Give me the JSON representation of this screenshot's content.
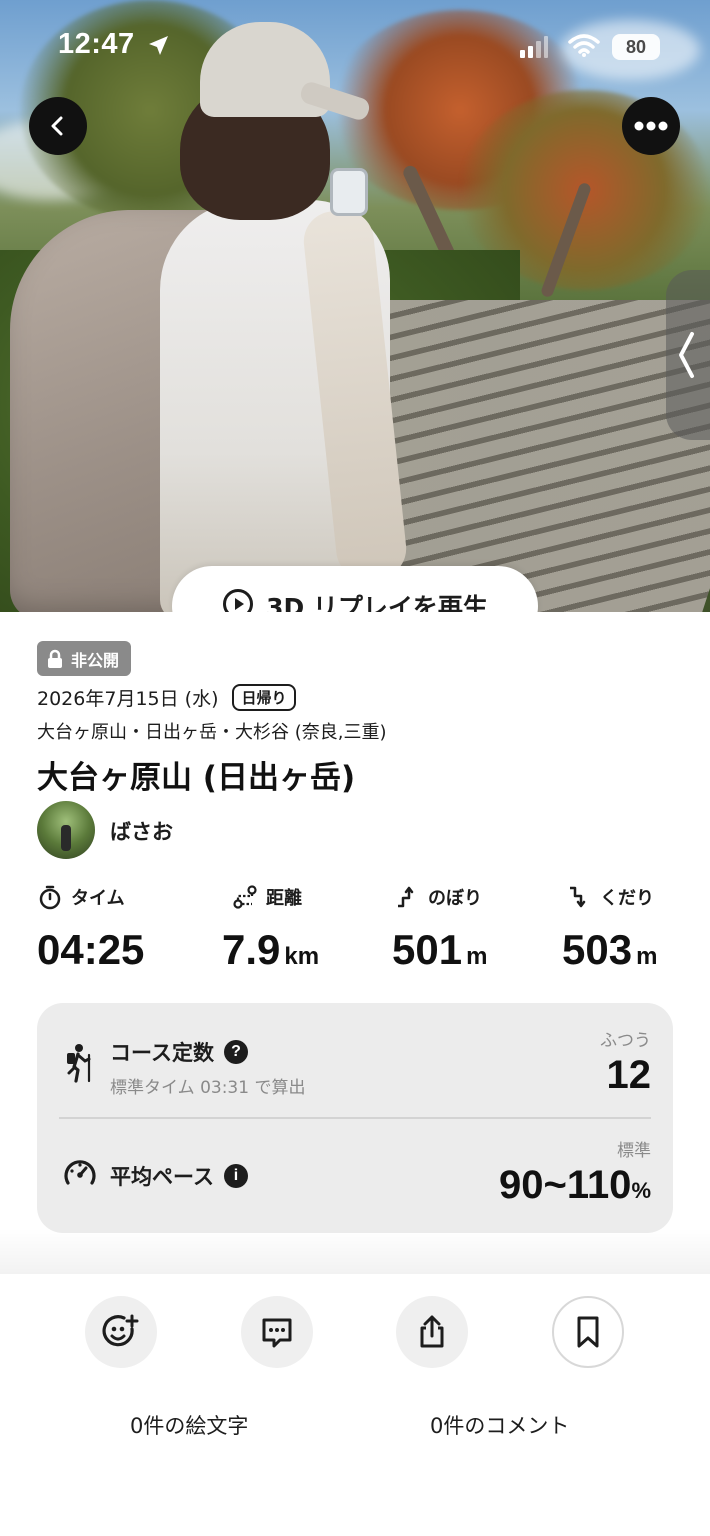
{
  "status_bar": {
    "time": "12:47",
    "battery": "80"
  },
  "hero": {
    "replay_label": "3D リプレイを再生"
  },
  "activity": {
    "visibility": "非公開",
    "date": "2026年7月15日 (水)",
    "trip_type": "日帰り",
    "area": "大台ヶ原山・日出ヶ岳・大杉谷 (奈良,三重)",
    "title": "大台ヶ原山 (日出ヶ岳)",
    "user_name": "ばさお"
  },
  "stats": [
    {
      "label": "タイム",
      "value": "04:25",
      "unit": "",
      "icon": "stopwatch-icon"
    },
    {
      "label": "距離",
      "value": "7.9",
      "unit": "km",
      "icon": "route-icon"
    },
    {
      "label": "のぼり",
      "value": "501",
      "unit": "m",
      "icon": "ascent-icon"
    },
    {
      "label": "くだり",
      "value": "503",
      "unit": "m",
      "icon": "descent-icon"
    }
  ],
  "metrics": {
    "course": {
      "label": "コース定数",
      "sub": "標準タイム 03:31 で算出",
      "side": "ふつう",
      "value": "12"
    },
    "pace": {
      "label": "平均ペース",
      "side": "標準",
      "value": "90~110",
      "unit": "%"
    }
  },
  "actions": {
    "emoji_count": "0件の絵文字",
    "comment_count": "0件のコメント"
  }
}
